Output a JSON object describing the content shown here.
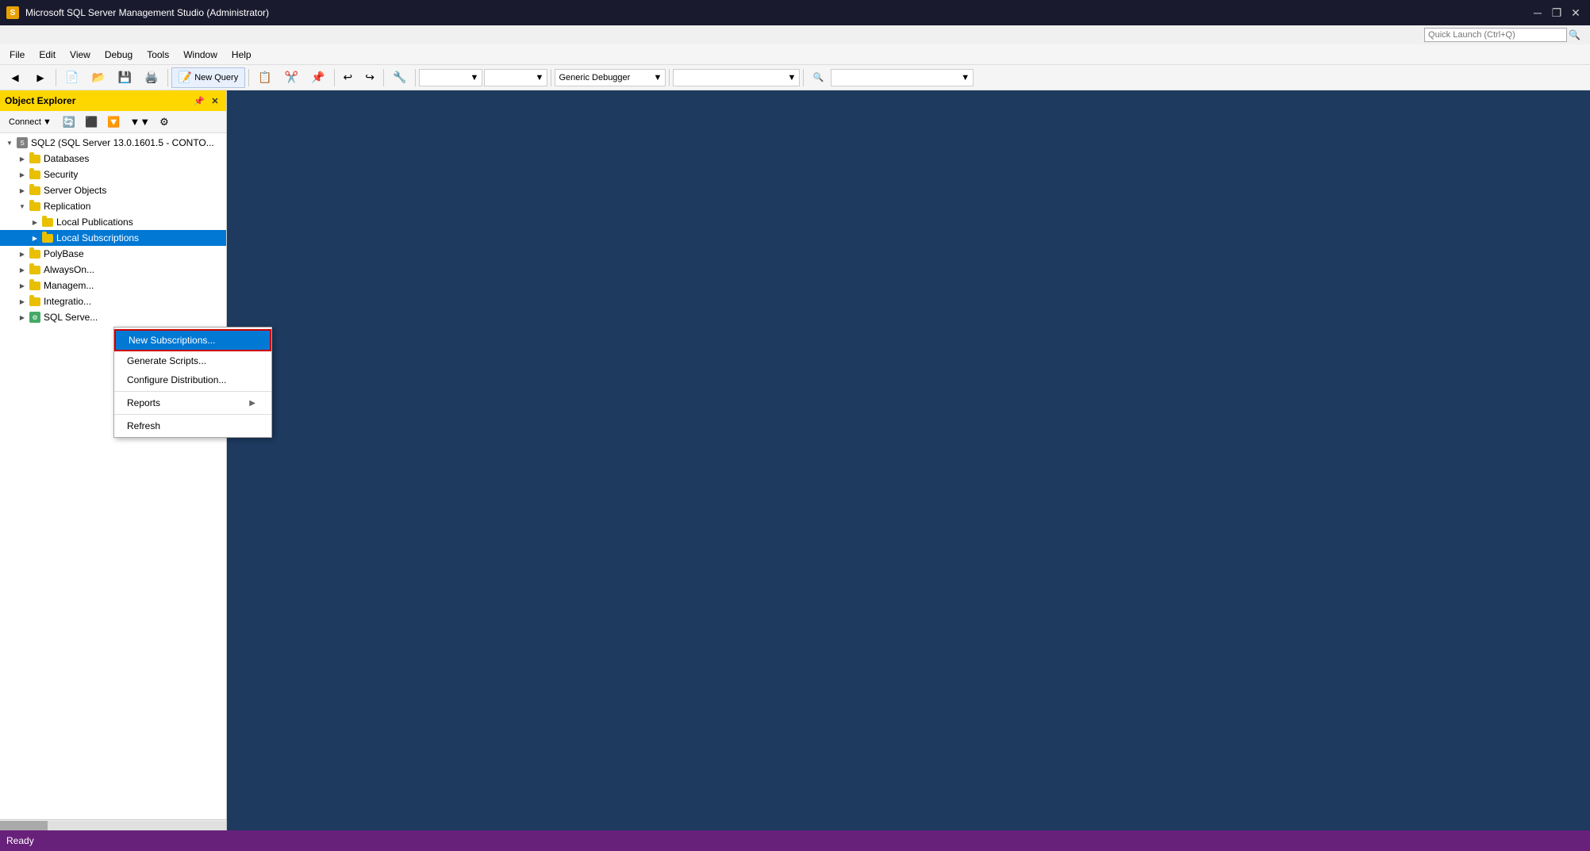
{
  "window": {
    "title": "Microsoft SQL Server Management Studio (Administrator)",
    "icon": "SQL"
  },
  "titlebar": {
    "title": "Microsoft SQL Server Management Studio (Administrator)",
    "minimize": "─",
    "restore": "❐",
    "close": "✕"
  },
  "quicklaunch": {
    "placeholder": "Quick Launch (Ctrl+Q)"
  },
  "menubar": {
    "items": [
      "File",
      "Edit",
      "View",
      "Debug",
      "Tools",
      "Window",
      "Help"
    ]
  },
  "toolbar": {
    "new_query": "New Query",
    "debugger_label": "Generic Debugger",
    "nav_back": "◀",
    "nav_forward": "▶",
    "undo": "↩",
    "redo": "↪"
  },
  "object_explorer": {
    "title": "Object Explorer",
    "connect_label": "Connect",
    "connect_arrow": "▼",
    "toolbar_icons": [
      "refresh",
      "filter",
      "collapse"
    ]
  },
  "tree": {
    "server_node": "SQL2 (SQL Server 13.0.1601.5 - CONTO...",
    "items": [
      {
        "label": "Databases",
        "level": 1,
        "expanded": false
      },
      {
        "label": "Security",
        "level": 1,
        "expanded": false
      },
      {
        "label": "Server Objects",
        "level": 1,
        "expanded": false
      },
      {
        "label": "Replication",
        "level": 1,
        "expanded": true
      },
      {
        "label": "Local Publications",
        "level": 2,
        "expanded": false
      },
      {
        "label": "Local Subscriptions",
        "level": 2,
        "expanded": false,
        "selected": true
      },
      {
        "label": "PolyBase",
        "level": 1,
        "expanded": false
      },
      {
        "label": "AlwaysOn...",
        "level": 1,
        "expanded": false
      },
      {
        "label": "Managem...",
        "level": 1,
        "expanded": false
      },
      {
        "label": "Integratio...",
        "level": 1,
        "expanded": false
      },
      {
        "label": "SQL Serve...",
        "level": 1,
        "expanded": false
      }
    ]
  },
  "context_menu": {
    "items": [
      {
        "label": "New Subscriptions...",
        "highlighted": true,
        "has_arrow": false
      },
      {
        "label": "Generate Scripts...",
        "highlighted": false,
        "has_arrow": false
      },
      {
        "label": "Configure Distribution...",
        "highlighted": false,
        "has_arrow": false
      },
      {
        "label": "Reports",
        "highlighted": false,
        "has_arrow": true
      },
      {
        "label": "Refresh",
        "highlighted": false,
        "has_arrow": false
      }
    ]
  },
  "status_bar": {
    "text": "Ready"
  }
}
